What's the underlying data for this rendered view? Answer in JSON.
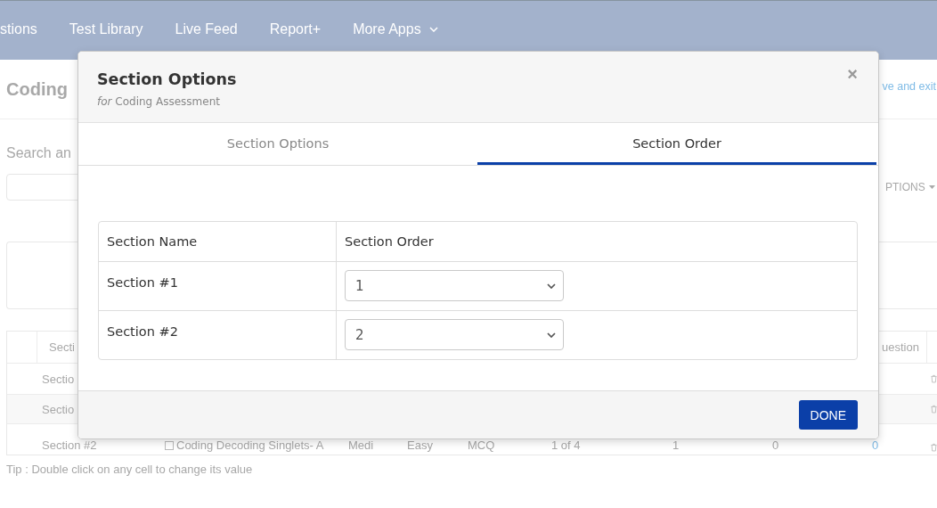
{
  "nav": {
    "items": [
      {
        "label": "stions",
        "kind": "link"
      },
      {
        "label": "Test Library",
        "kind": "link"
      },
      {
        "label": "Live Feed",
        "kind": "link"
      },
      {
        "label": "Report+",
        "kind": "link"
      },
      {
        "label": "More Apps",
        "kind": "dropdown"
      }
    ]
  },
  "page": {
    "title": "Coding",
    "header_link": "ve and exit",
    "search_label": "Search an",
    "dropdown_button": "PTIONS",
    "table": {
      "columns": [
        "Secti",
        "uestion"
      ],
      "rows": [
        {
          "cells": [
            {
              "text": "Sectio",
              "kind": "text"
            }
          ]
        },
        {
          "cells": [
            {
              "text": "Sectio",
              "kind": "text"
            }
          ]
        },
        {
          "cells": [
            {
              "text": "Section #2",
              "kind": "text"
            },
            {
              "text": "Coding Decoding Singlets- A",
              "kind": "text",
              "checked": false
            },
            {
              "text": "Medi",
              "kind": "text"
            },
            {
              "text": "Easy",
              "kind": "text"
            },
            {
              "text": "MCQ",
              "kind": "text"
            },
            {
              "text": "1 of 4",
              "kind": "text"
            },
            {
              "text": "1",
              "kind": "text"
            },
            {
              "text": "0",
              "kind": "text"
            },
            {
              "text": "0",
              "kind": "link"
            }
          ]
        }
      ]
    },
    "tip": "Tip : Double click on any cell to change its value"
  },
  "modal": {
    "title": "Section Options",
    "subtitle": "*for* Coding Assessment",
    "close": "×",
    "tabs": [
      {
        "label": "Section Options",
        "selected": false
      },
      {
        "label": "Section Order",
        "selected": true
      }
    ],
    "table": {
      "columns": [
        "Section Name",
        "Section Order"
      ],
      "rows": [
        {
          "name": "Section #1",
          "order": "1"
        },
        {
          "name": "Section #2",
          "order": "2"
        }
      ]
    },
    "done_button": "DONE"
  }
}
